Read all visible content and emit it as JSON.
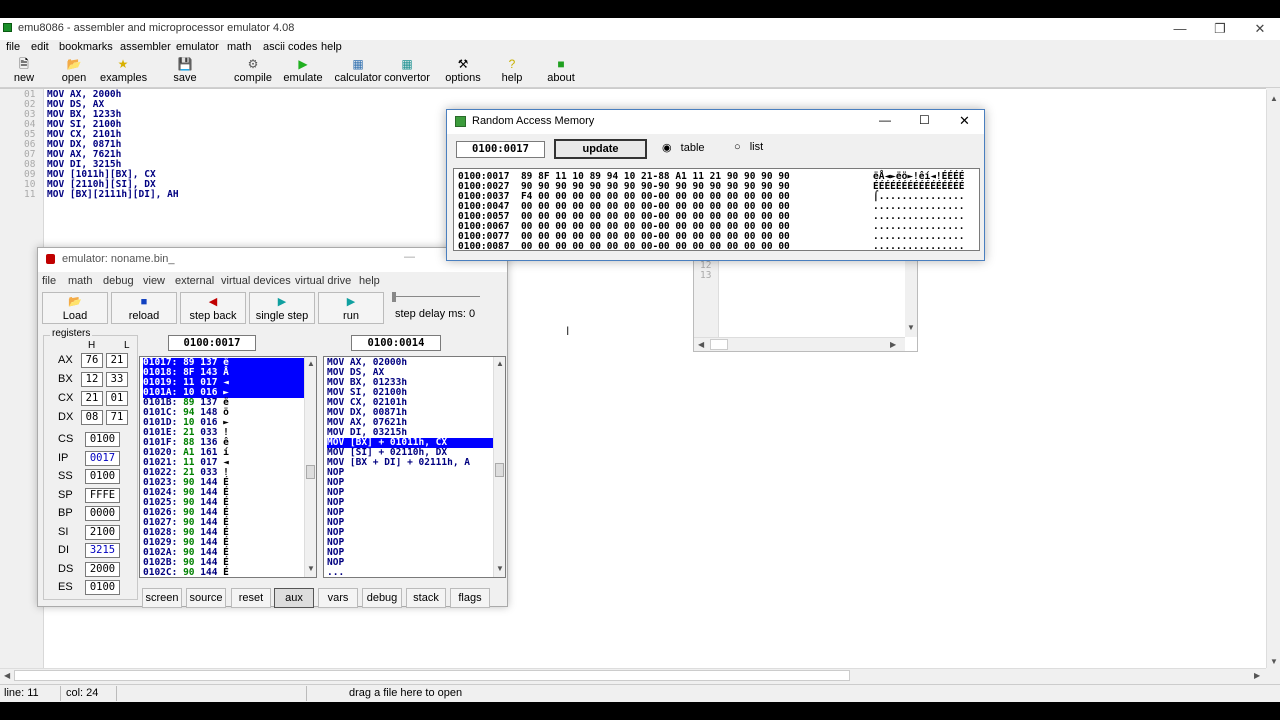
{
  "main": {
    "title": "emu8086 - assembler and microprocessor emulator 4.08",
    "menu": [
      "file",
      "edit",
      "bookmarks",
      "assembler",
      "emulator",
      "math",
      "ascii codes",
      "help"
    ],
    "toolbar": {
      "new": "new",
      "open": "open",
      "examples": "examples",
      "save": "save",
      "compile": "compile",
      "emulate": "emulate",
      "calculator": "calculator",
      "convertor": "convertor",
      "options": "options",
      "help": "help",
      "about": "about"
    },
    "code_lines": [
      {
        "n": "01",
        "text": "MOV AX, 2000h"
      },
      {
        "n": "02",
        "text": "MOV DS, AX"
      },
      {
        "n": "03",
        "text": "MOV BX, 1233h"
      },
      {
        "n": "04",
        "text": "MOV SI, 2100h"
      },
      {
        "n": "05",
        "text": "MOV CX, 2101h"
      },
      {
        "n": "06",
        "text": "MOV DX, 0871h"
      },
      {
        "n": "07",
        "text": "MOV AX, 7621h"
      },
      {
        "n": "08",
        "text": "MOV DI, 3215h"
      },
      {
        "n": "09",
        "text": "MOV [1011h][BX], CX"
      },
      {
        "n": "10",
        "text": "MOV [2110h][SI], DX"
      },
      {
        "n": "11",
        "text": "MOV [BX][2111h][DI], AH"
      }
    ],
    "status": {
      "line": "line: 11",
      "col": "col: 24",
      "hint": "drag a file here to open"
    }
  },
  "bg_window": {
    "lines": [
      "12",
      "13"
    ]
  },
  "ram": {
    "title": "Random Access Memory",
    "address": "0100:0017",
    "update_label": "update",
    "mode_table": "table",
    "mode_list": "list",
    "selected_mode": "table",
    "rows": [
      {
        "addr": "0100:0017",
        "hex": "89 8F 11 10 89 94 10 21-88 A1 11 21 90 90 90 90",
        "ascii": "ëÅ◄►ëö►!êí◄!ÉÉÉÉ"
      },
      {
        "addr": "0100:0027",
        "hex": "90 90 90 90 90 90 90 90-90 90 90 90 90 90 90 90",
        "ascii": "ÉÉÉÉÉÉÉÉÉÉÉÉÉÉÉÉ"
      },
      {
        "addr": "0100:0037",
        "hex": "F4 00 00 00 00 00 00 00-00 00 00 00 00 00 00 00",
        "ascii": "⌠..............."
      },
      {
        "addr": "0100:0047",
        "hex": "00 00 00 00 00 00 00 00-00 00 00 00 00 00 00 00",
        "ascii": "................"
      },
      {
        "addr": "0100:0057",
        "hex": "00 00 00 00 00 00 00 00-00 00 00 00 00 00 00 00",
        "ascii": "................"
      },
      {
        "addr": "0100:0067",
        "hex": "00 00 00 00 00 00 00 00-00 00 00 00 00 00 00 00",
        "ascii": "................"
      },
      {
        "addr": "0100:0077",
        "hex": "00 00 00 00 00 00 00 00-00 00 00 00 00 00 00 00",
        "ascii": "................"
      },
      {
        "addr": "0100:0087",
        "hex": "00 00 00 00 00 00 00 00-00 00 00 00 00 00 00 00",
        "ascii": "................"
      }
    ]
  },
  "emulator": {
    "title": "emulator: noname.bin_",
    "menu": [
      "file",
      "math",
      "debug",
      "view",
      "external",
      "virtual devices",
      "virtual drive",
      "help"
    ],
    "buttons": {
      "load": "Load",
      "reload": "reload",
      "step_back": "step back",
      "single_step": "single step",
      "run": "run",
      "step_delay": "step delay ms: 0"
    },
    "registers_label": "registers",
    "h_label": "H",
    "l_label": "L",
    "regs_hl": [
      {
        "name": "AX",
        "h": "76",
        "l": "21"
      },
      {
        "name": "BX",
        "h": "12",
        "l": "33"
      },
      {
        "name": "CX",
        "h": "21",
        "l": "01"
      },
      {
        "name": "DX",
        "h": "08",
        "l": "71"
      }
    ],
    "regs": [
      {
        "name": "CS",
        "value": "0100"
      },
      {
        "name": "IP",
        "value": "0017"
      },
      {
        "name": "SS",
        "value": "0100"
      },
      {
        "name": "SP",
        "value": "FFFE"
      },
      {
        "name": "BP",
        "value": "0000"
      },
      {
        "name": "SI",
        "value": "2100"
      },
      {
        "name": "DI",
        "value": "3215"
      },
      {
        "name": "DS",
        "value": "2000"
      },
      {
        "name": "ES",
        "value": "0100"
      }
    ],
    "mem_address": "0100:0017",
    "dis_address": "0100:0014",
    "memory_rows": [
      {
        "addr": "01017:",
        "hex": "89",
        "dec": "137",
        "ch": "ë",
        "sel": true
      },
      {
        "addr": "01018:",
        "hex": "8F",
        "dec": "143",
        "ch": "Å",
        "sel": true
      },
      {
        "addr": "01019:",
        "hex": "11",
        "dec": "017",
        "ch": "◄",
        "sel": true
      },
      {
        "addr": "0101A:",
        "hex": "10",
        "dec": "016",
        "ch": "►",
        "sel": true
      },
      {
        "addr": "0101B:",
        "hex": "89",
        "dec": "137",
        "ch": "ë",
        "sel": false
      },
      {
        "addr": "0101C:",
        "hex": "94",
        "dec": "148",
        "ch": "ö",
        "sel": false
      },
      {
        "addr": "0101D:",
        "hex": "10",
        "dec": "016",
        "ch": "►",
        "sel": false
      },
      {
        "addr": "0101E:",
        "hex": "21",
        "dec": "033",
        "ch": "!",
        "sel": false
      },
      {
        "addr": "0101F:",
        "hex": "88",
        "dec": "136",
        "ch": "ê",
        "sel": false
      },
      {
        "addr": "01020:",
        "hex": "A1",
        "dec": "161",
        "ch": "í",
        "sel": false
      },
      {
        "addr": "01021:",
        "hex": "11",
        "dec": "017",
        "ch": "◄",
        "sel": false
      },
      {
        "addr": "01022:",
        "hex": "21",
        "dec": "033",
        "ch": "!",
        "sel": false
      },
      {
        "addr": "01023:",
        "hex": "90",
        "dec": "144",
        "ch": "É",
        "sel": false
      },
      {
        "addr": "01024:",
        "hex": "90",
        "dec": "144",
        "ch": "É",
        "sel": false
      },
      {
        "addr": "01025:",
        "hex": "90",
        "dec": "144",
        "ch": "É",
        "sel": false
      },
      {
        "addr": "01026:",
        "hex": "90",
        "dec": "144",
        "ch": "É",
        "sel": false
      },
      {
        "addr": "01027:",
        "hex": "90",
        "dec": "144",
        "ch": "É",
        "sel": false
      },
      {
        "addr": "01028:",
        "hex": "90",
        "dec": "144",
        "ch": "É",
        "sel": false
      },
      {
        "addr": "01029:",
        "hex": "90",
        "dec": "144",
        "ch": "É",
        "sel": false
      },
      {
        "addr": "0102A:",
        "hex": "90",
        "dec": "144",
        "ch": "É",
        "sel": false
      },
      {
        "addr": "0102B:",
        "hex": "90",
        "dec": "144",
        "ch": "É",
        "sel": false
      },
      {
        "addr": "0102C:",
        "hex": "90",
        "dec": "144",
        "ch": "É",
        "sel": false
      }
    ],
    "disasm_rows": [
      {
        "text": "MOV AX, 02000h",
        "sel": false
      },
      {
        "text": "MOV DS, AX",
        "sel": false
      },
      {
        "text": "MOV BX, 01233h",
        "sel": false
      },
      {
        "text": "MOV SI, 02100h",
        "sel": false
      },
      {
        "text": "MOV CX, 02101h",
        "sel": false
      },
      {
        "text": "MOV DX, 00871h",
        "sel": false
      },
      {
        "text": "MOV AX, 07621h",
        "sel": false
      },
      {
        "text": "MOV DI, 03215h",
        "sel": false
      },
      {
        "text": "MOV [BX] + 01011h, CX",
        "sel": true
      },
      {
        "text": "MOV [SI] + 02110h, DX",
        "sel": false
      },
      {
        "text": "MOV [BX + DI] + 02111h, A",
        "sel": false
      },
      {
        "text": "NOP",
        "sel": false
      },
      {
        "text": "NOP",
        "sel": false
      },
      {
        "text": "NOP",
        "sel": false
      },
      {
        "text": "NOP",
        "sel": false
      },
      {
        "text": "NOP",
        "sel": false
      },
      {
        "text": "NOP",
        "sel": false
      },
      {
        "text": "NOP",
        "sel": false
      },
      {
        "text": "NOP",
        "sel": false
      },
      {
        "text": "NOP",
        "sel": false
      },
      {
        "text": "NOP",
        "sel": false
      },
      {
        "text": "...",
        "sel": false
      }
    ],
    "bottom_buttons": [
      "screen",
      "source",
      "reset",
      "aux",
      "vars",
      "debug",
      "stack",
      "flags"
    ],
    "active_bottom": "aux"
  },
  "colors": {
    "selection": "#0000ff",
    "code_text": "#000080",
    "hex_green": "#008000",
    "ip_value": "#0000c0"
  }
}
